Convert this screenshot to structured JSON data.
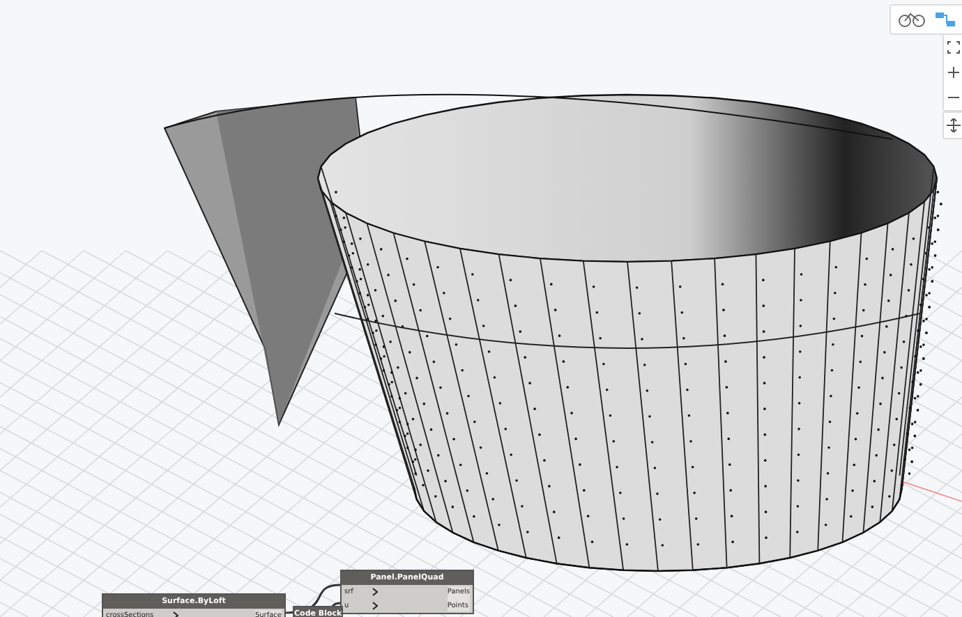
{
  "nodes": [
    {
      "title": "Surface.ByLoft",
      "inputs": [
        "crossSections"
      ],
      "outputs": [
        "Surface"
      ]
    },
    {
      "title": "Panel.PanelQuad",
      "inputs": [
        "srf",
        "u"
      ],
      "outputs": [
        "Panels",
        "Points"
      ]
    },
    {
      "title": "Code Block"
    }
  ]
}
